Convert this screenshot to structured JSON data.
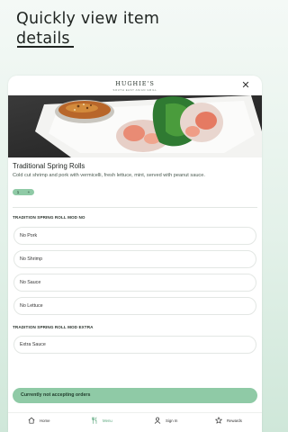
{
  "promo": {
    "line1": "Quickly view item",
    "line2": "details"
  },
  "brand": {
    "name": "HUGHIE'S",
    "tagline": "SOUTH EAST ASIAN GRILL"
  },
  "item": {
    "title": "Traditional Spring Rolls",
    "description": "Cold cut shrimp and pork with vermicelli, fresh lettuce, mint, served with peanut sauce.",
    "quantity": "1",
    "qty_plus": "+"
  },
  "sections": [
    {
      "title": "TRADITION SPRING ROLL MOD NO",
      "options": [
        "No Pork",
        "No Shrimp",
        "No Sauce",
        "No Lettuce"
      ]
    },
    {
      "title": "TRADITION SPRING ROLL MOD EXTRA",
      "options": [
        "Extra Sauce"
      ]
    }
  ],
  "status": "Currently not accepting orders",
  "nav": {
    "items": [
      {
        "label": "Home",
        "icon": "home-icon"
      },
      {
        "label": "Menu",
        "icon": "utensils-icon"
      },
      {
        "label": "Sign In",
        "icon": "user-icon"
      },
      {
        "label": "Rewards",
        "icon": "star-icon"
      }
    ]
  },
  "colors": {
    "accent": "#8fcaa6",
    "accent_text": "#5aa77c"
  }
}
